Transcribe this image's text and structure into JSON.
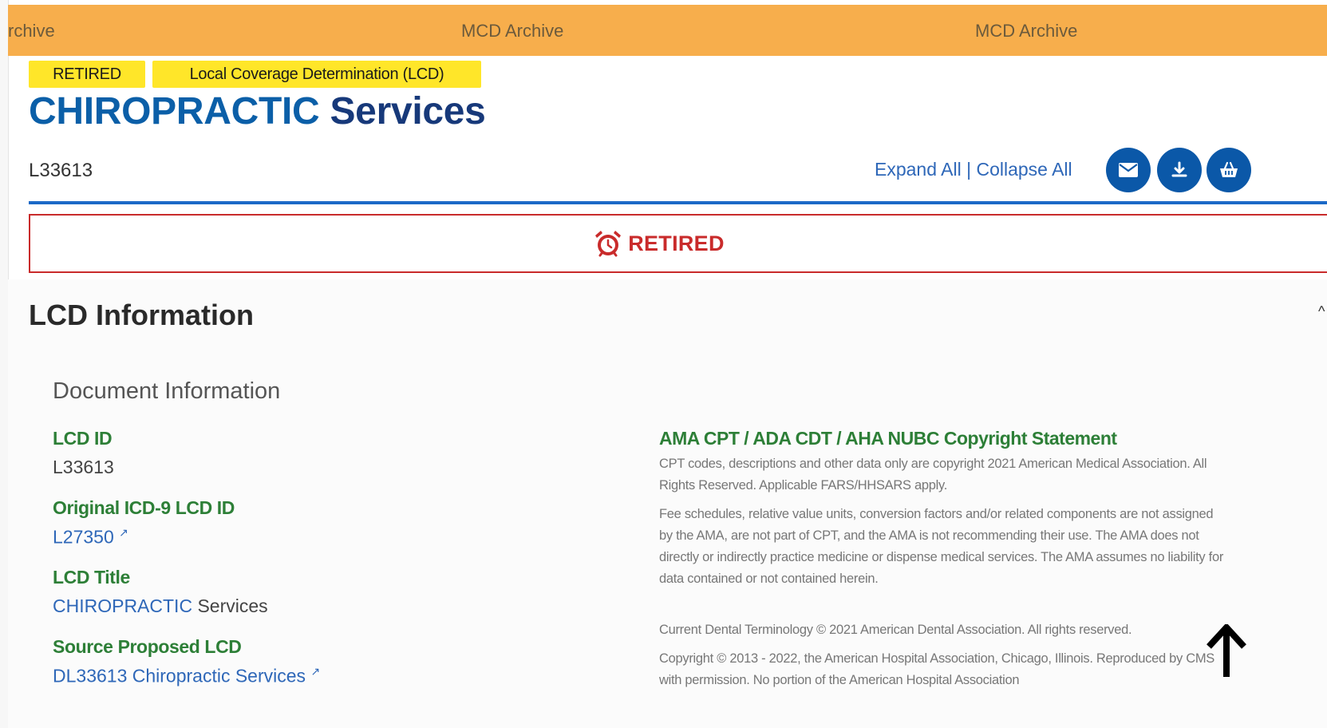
{
  "banner": {
    "items": [
      "rchive",
      "MCD Archive",
      "MCD Archive"
    ]
  },
  "badges": {
    "retired": "RETIRED",
    "lcd_type": "Local Coverage Determination (LCD)"
  },
  "title": {
    "part1": "CHIROPRACTIC",
    "part2": "Services"
  },
  "document_id": "L33613",
  "toolbar": {
    "expand_all": "Expand All",
    "separator": "|",
    "collapse_all": "Collapse All",
    "icons": [
      "envelope-icon",
      "download-icon",
      "basket-icon"
    ]
  },
  "status_banner": {
    "label": "RETIRED",
    "icon": "alarm-clock-icon",
    "color": "#c92b2b"
  },
  "section": {
    "title": "LCD Information",
    "subsection": "Document Information"
  },
  "fields": {
    "lcd_id_label": "LCD ID",
    "lcd_id_value": "L33613",
    "icd9_label": "Original ICD-9 LCD ID",
    "icd9_value": "L27350",
    "lcd_title_label": "LCD Title",
    "lcd_title_part1": "CHIROPRACTIC",
    "lcd_title_part2": "Services",
    "source_label": "Source Proposed LCD",
    "source_value": "DL33613 Chiropractic Services"
  },
  "copyright": {
    "heading": "AMA CPT / ADA CDT / AHA NUBC Copyright Statement",
    "p1": "CPT codes, descriptions and other data only are copyright 2021 American Medical Association. All Rights Reserved. Applicable FARS/HHSARS apply.",
    "p2": "Fee schedules, relative value units, conversion factors and/or related components are not assigned by the AMA, are not part of CPT, and the AMA is not recommending their use. The AMA does not directly or indirectly practice medicine or dispense medical services. The AMA assumes no liability for data contained or not contained herein.",
    "p3": "Current Dental Terminology © 2021 American Dental Association. All rights reserved.",
    "p4": "Copyright © 2013 - 2022, the American Hospital Association, Chicago, Illinois. Reproduced by CMS with permission. No portion of the American Hospital Association"
  },
  "colors": {
    "banner": "#f7ae4c",
    "badge": "#ffe629",
    "primary_blue": "#0b58a8",
    "green_label": "#2d7f37"
  }
}
